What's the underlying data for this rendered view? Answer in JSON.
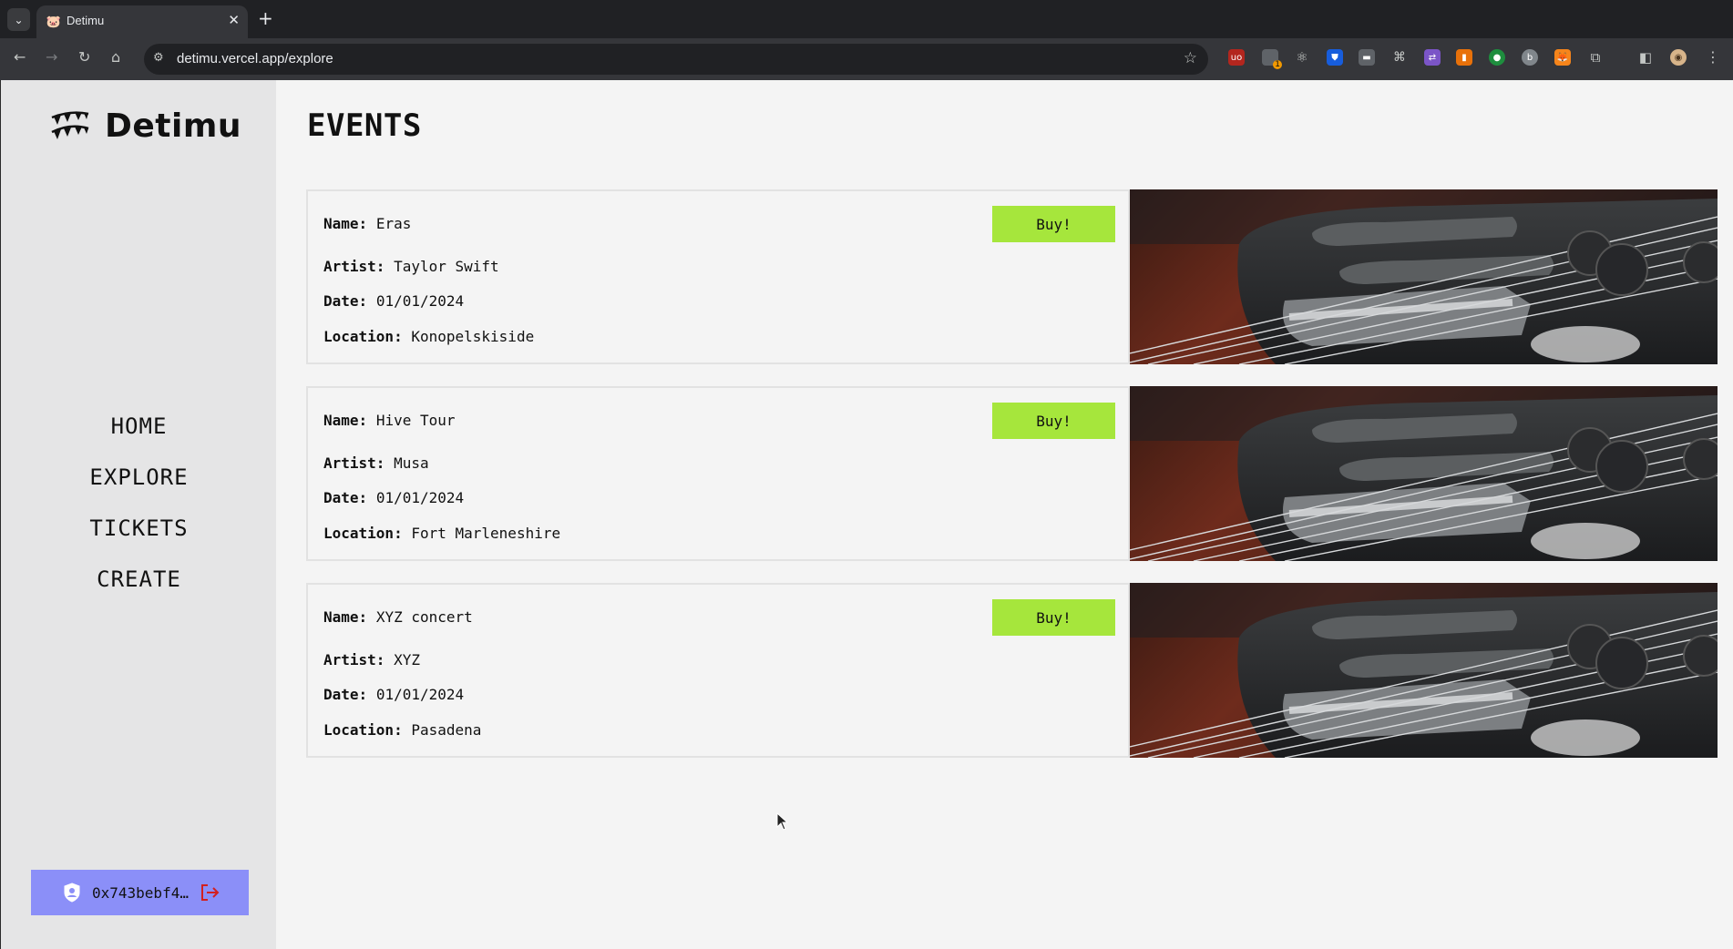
{
  "browser": {
    "tab_title": "Detimu",
    "tab_favicon": "pig-icon",
    "url": "detimu.vercel.app/explore",
    "ext_badge": "1"
  },
  "sidebar": {
    "brand": "Detimu",
    "nav": [
      "HOME",
      "EXPLORE",
      "TICKETS",
      "CREATE"
    ],
    "wallet_address": "0x743bebf4…"
  },
  "main": {
    "title": "EVENTS",
    "events": [
      {
        "name_label": "Name:",
        "name": "Eras",
        "artist_label": "Artist:",
        "artist": "Taylor Swift",
        "date_label": "Date:",
        "date": "01/01/2024",
        "location_label": "Location:",
        "location": "Konopelskiside",
        "buy": "Buy!"
      },
      {
        "name_label": "Name:",
        "name": "Hive Tour",
        "artist_label": "Artist:",
        "artist": "Musa",
        "date_label": "Date:",
        "date": "01/01/2024",
        "location_label": "Location:",
        "location": "Fort Marleneshire",
        "buy": "Buy!"
      },
      {
        "name_label": "Name:",
        "name": "XYZ concert",
        "artist_label": "Artist:",
        "artist": "XYZ",
        "date_label": "Date:",
        "date": "01/01/2024",
        "location_label": "Location:",
        "location": "Pasadena",
        "buy": "Buy!"
      }
    ]
  },
  "colors": {
    "buy_button": "#a6e63c",
    "wallet_bg": "#8b8ff8",
    "sidebar_bg": "#e5e5e6",
    "page_bg": "#f4f4f4"
  }
}
